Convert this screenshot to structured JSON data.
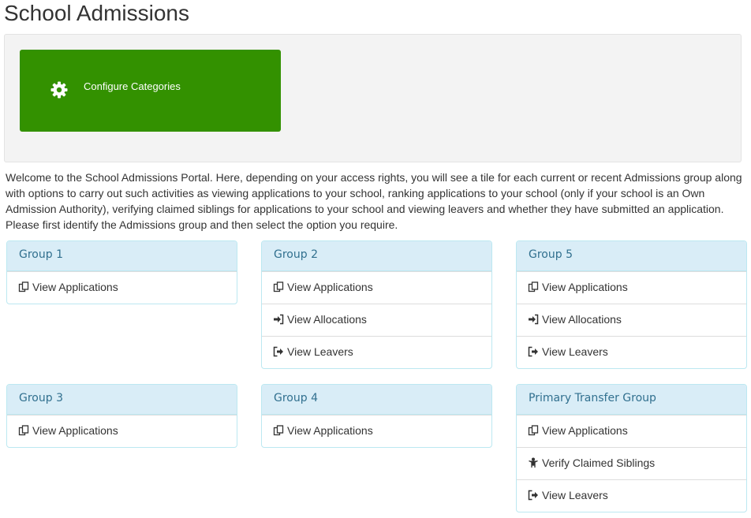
{
  "page": {
    "title": "School Admissions"
  },
  "tile": {
    "label": "Configure Categories",
    "icon": "gear-icon",
    "color": "#339100"
  },
  "intro": "Welcome to the School Admissions Portal. Here, depending on your access rights, you will see a tile for each current or recent Admissions group along with options to carry out such activities as viewing applications to your school, ranking applications to your school (only if your school is an Own Admission Authority), verifying claimed siblings for applications to your school and viewing leavers and whether they have submitted an application. Please first identify the Admissions group and then select the option you require.",
  "groups": [
    {
      "title": "Group 1",
      "items": [
        {
          "label": "View Applications",
          "icon": "copy-icon"
        }
      ]
    },
    {
      "title": "Group 2",
      "items": [
        {
          "label": "View Applications",
          "icon": "copy-icon"
        },
        {
          "label": "View Allocations",
          "icon": "sign-in-icon"
        },
        {
          "label": "View Leavers",
          "icon": "sign-out-icon"
        }
      ]
    },
    {
      "title": "Group 5",
      "items": [
        {
          "label": "View Applications",
          "icon": "copy-icon"
        },
        {
          "label": "View Allocations",
          "icon": "sign-in-icon"
        },
        {
          "label": "View Leavers",
          "icon": "sign-out-icon"
        }
      ]
    },
    {
      "title": "Group 3",
      "items": [
        {
          "label": "View Applications",
          "icon": "copy-icon"
        }
      ]
    },
    {
      "title": "Group 4",
      "items": [
        {
          "label": "View Applications",
          "icon": "copy-icon"
        }
      ]
    },
    {
      "title": "Primary Transfer Group",
      "items": [
        {
          "label": "View Applications",
          "icon": "copy-icon"
        },
        {
          "label": "Verify Claimed Siblings",
          "icon": "child-icon"
        },
        {
          "label": "View Leavers",
          "icon": "sign-out-icon"
        }
      ]
    }
  ]
}
